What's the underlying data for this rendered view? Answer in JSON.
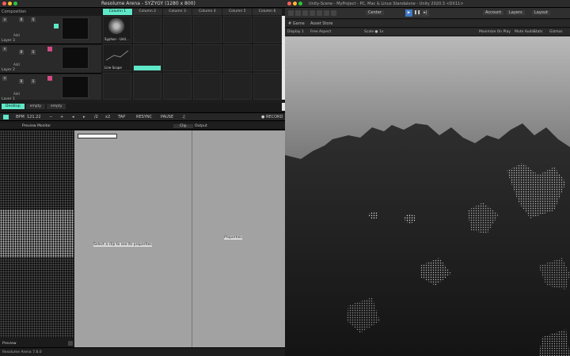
{
  "arena": {
    "title": "Resolume Arena - SYZYGY (1280 x 800)",
    "composition_label": "Composition",
    "columns": [
      "Column 1",
      "Column 2",
      "Column 3",
      "Column 4",
      "Column 5",
      "Column 6"
    ],
    "layers": [
      {
        "name": "Layer 3",
        "add": "Add"
      },
      {
        "name": "Layer 2",
        "add": "Add"
      },
      {
        "name": "Layer 1",
        "add": "Add"
      }
    ],
    "clips": {
      "layer3_col1": "Syphon - Unit...",
      "layer2_col1": "Line Scope"
    },
    "deck_tabs": [
      "Desktop",
      "empty",
      "empty"
    ],
    "transport": {
      "bpm_label": "BPM",
      "bpm_value": "121.22",
      "tap": "TAP",
      "resync": "RESYNC",
      "pause": "PAUSE",
      "record": "● RECORD"
    },
    "panels": {
      "preview_monitor": "Preview Monitor",
      "clip_tab": "Clip",
      "output_tab": "Output",
      "clip_message": "Select a clip to see its properties",
      "output_message": "Properties",
      "preview_label": "Preview"
    },
    "status": "Resolume Arena 7.8.0"
  },
  "unity": {
    "title": "Unity-Scene - MyProject - PC, Mac & Linux Standalone - Unity 2020.3 <DX11>",
    "toolbar": {
      "center": "Center",
      "account": "Account",
      "layers": "Layers",
      "layout": "Layout"
    },
    "tabs": {
      "scene": "# Game",
      "asset": "Asset Store"
    },
    "scene_toolbar": {
      "display": "Display 1",
      "aspect": "Free Aspect",
      "scale": "Scale ●  1x",
      "maximize": "Maximize On Play",
      "mute": "Mute Audio",
      "stats": "Stats",
      "gizmos": "Gizmos"
    }
  },
  "colors": {
    "accent": "#5ee8c8",
    "record_pink": "#d44a85",
    "play_blue": "#3e78c8"
  }
}
